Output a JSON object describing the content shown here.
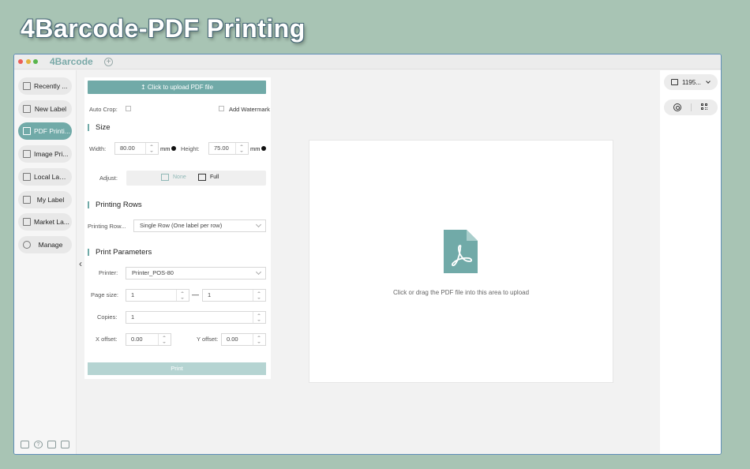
{
  "hero": {
    "title": "4Barcode-PDF Printing"
  },
  "window": {
    "app_name": "4Barcode",
    "add_tab": "+"
  },
  "sidebar": {
    "items": [
      {
        "label": "Recently ...",
        "active": false
      },
      {
        "label": "New Label",
        "active": false
      },
      {
        "label": "PDF Printi...",
        "active": true
      },
      {
        "label": "Image Pri...",
        "active": false
      },
      {
        "label": "Local Label",
        "active": false
      },
      {
        "label": "My Label",
        "active": false
      },
      {
        "label": "Market La...",
        "active": false
      },
      {
        "label": "Manage",
        "active": false
      }
    ]
  },
  "panel": {
    "upload_label": "Click to upload PDF file",
    "auto_crop_label": "Auto Crop:",
    "watermark_label": "Add Watermark",
    "size_section": "Size",
    "width_label": "Width:",
    "width_value": "80.00",
    "width_unit": "mm",
    "height_label": "Height:",
    "height_value": "75.00",
    "height_unit": "mm",
    "adjust_label": "Adjust:",
    "adjust_none": "None",
    "adjust_full": "Full",
    "rows_section": "Printing Rows",
    "rows_label": "Printing Row...",
    "rows_value": "Single Row (One label per row)",
    "params_section": "Print Parameters",
    "printer_label": "Printer:",
    "printer_value": "Printer_POS-80",
    "page_size_label": "Page size:",
    "page_from": "1",
    "page_dash": "—",
    "page_to": "1",
    "copies_label": "Copies:",
    "copies_value": "1",
    "x_offset_label": "X offset:",
    "x_offset_value": "0.00",
    "y_offset_label": "Y offset:",
    "y_offset_value": "0.00",
    "print_label": "Print"
  },
  "preview": {
    "drop_text": "Click or drag the PDF file into this area to upload"
  },
  "right": {
    "printer_name": "1195..."
  },
  "colors": {
    "accent": "#71aaa8",
    "background": "#a8c4b4"
  }
}
